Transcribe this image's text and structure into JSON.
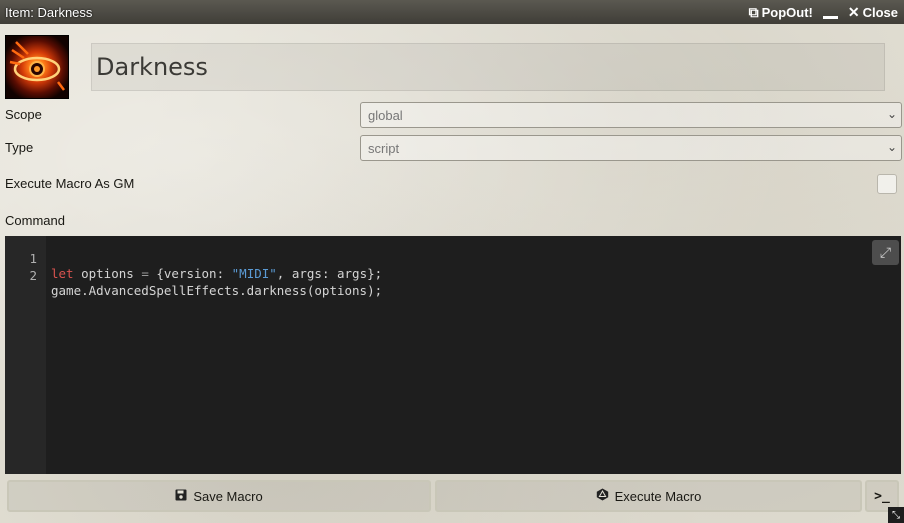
{
  "window": {
    "title": "Item: Darkness",
    "popout_label": "PopOut!",
    "close_label": "Close"
  },
  "item": {
    "name": "Darkness",
    "image_icon": "darkness-eye-icon"
  },
  "fields": {
    "scope": {
      "label": "Scope",
      "value": "global"
    },
    "type": {
      "label": "Type",
      "value": "script"
    },
    "execute_as_gm": {
      "label": "Execute Macro As GM",
      "checked": false
    },
    "command_label": "Command"
  },
  "editor": {
    "lines": [
      {
        "num": "1",
        "kw": "let",
        "rest1": " options ",
        "op": "=",
        "rest2": " {version: ",
        "str": "\"MIDI\"",
        "rest3": ", args: args};"
      },
      {
        "num": "2",
        "text": "game.AdvancedSpellEffects.darkness(options);"
      }
    ],
    "colors": {
      "background": "#1e1e1e",
      "keyword": "#d9534f",
      "string": "#5b9bd5"
    }
  },
  "buttons": {
    "save_label": "Save Macro",
    "execute_label": "Execute Macro",
    "console_label": ">_"
  }
}
